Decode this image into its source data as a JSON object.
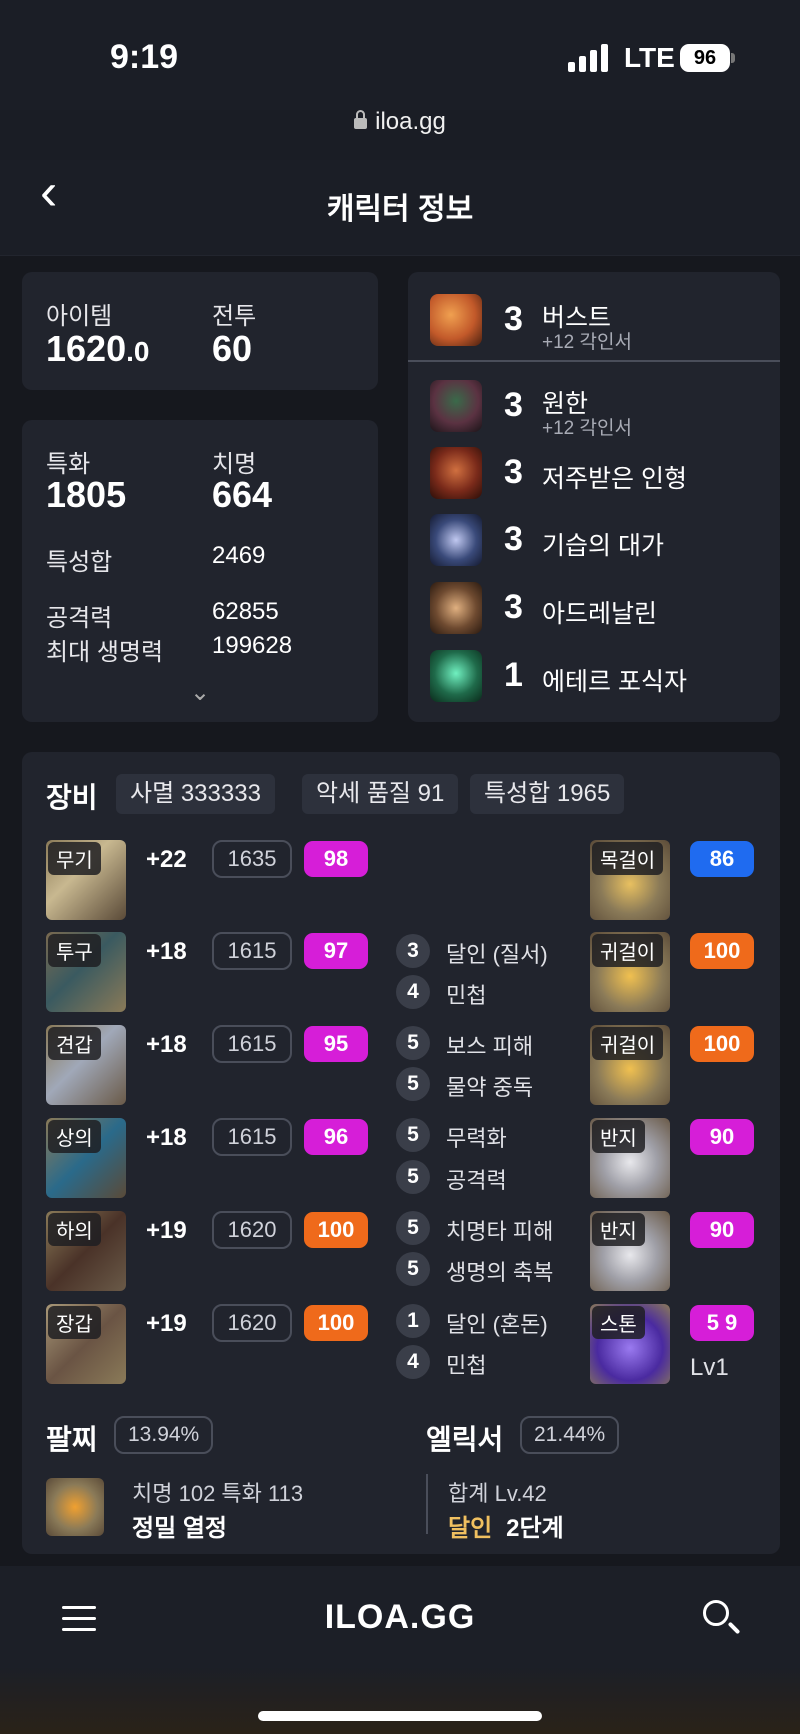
{
  "status": {
    "time": "9:19",
    "network": "LTE",
    "battery": "96"
  },
  "browser": {
    "url": "iloa.gg"
  },
  "header": {
    "back": "‹",
    "title": "캐릭터 정보"
  },
  "summary": {
    "item_label": "아이템",
    "item_value": "1620",
    "item_decimal": ".0",
    "combat_label": "전투",
    "combat_value": "60"
  },
  "stats": {
    "spec_label": "특화",
    "spec_value": "1805",
    "crit_label": "치명",
    "crit_value": "664",
    "total_label": "특성합",
    "total_value": "2469",
    "atk_label": "공격력",
    "atk_value": "62855",
    "hp_label": "최대 생명력",
    "hp_value": "199628",
    "expand": "⌄"
  },
  "engravings": [
    {
      "level": "3",
      "name": "버스트",
      "sub": "+12 각인서",
      "color": "#c2592a"
    },
    {
      "level": "3",
      "name": "원한",
      "sub": "+12 각인서",
      "color": "#5b3242"
    },
    {
      "level": "3",
      "name": "저주받은 인형",
      "sub": "",
      "color": "#7a2a1a"
    },
    {
      "level": "3",
      "name": "기습의 대가",
      "sub": "",
      "color": "#3a4a7a"
    },
    {
      "level": "3",
      "name": "아드레날린",
      "sub": "",
      "color": "#6e4a30"
    },
    {
      "level": "1",
      "name": "에테르 포식자",
      "sub": "",
      "color": "#1f6a4a"
    }
  ],
  "equipment": {
    "title": "장비",
    "pills": [
      "사멸 333333",
      "악세 품질 91",
      "특성합 1965"
    ],
    "armor": [
      {
        "tag": "무기",
        "refine": "+22",
        "ilvl": "1635",
        "quality": "98",
        "qcolor": "purple"
      },
      {
        "tag": "투구",
        "refine": "+18",
        "ilvl": "1615",
        "quality": "97",
        "qcolor": "purple"
      },
      {
        "tag": "견갑",
        "refine": "+18",
        "ilvl": "1615",
        "quality": "95",
        "qcolor": "purple"
      },
      {
        "tag": "상의",
        "refine": "+18",
        "ilvl": "1615",
        "quality": "96",
        "qcolor": "purple"
      },
      {
        "tag": "하의",
        "refine": "+19",
        "ilvl": "1620",
        "quality": "100",
        "qcolor": "orange"
      },
      {
        "tag": "장갑",
        "refine": "+19",
        "ilvl": "1620",
        "quality": "100",
        "qcolor": "orange"
      }
    ],
    "effects": [
      {
        "num": "3",
        "name": "달인 (질서)"
      },
      {
        "num": "4",
        "name": "민첩"
      },
      {
        "num": "5",
        "name": "보스 피해"
      },
      {
        "num": "5",
        "name": "물약 중독"
      },
      {
        "num": "5",
        "name": "무력화"
      },
      {
        "num": "5",
        "name": "공격력"
      },
      {
        "num": "5",
        "name": "치명타 피해"
      },
      {
        "num": "5",
        "name": "생명의 축복"
      },
      {
        "num": "1",
        "name": "달인 (혼돈)"
      },
      {
        "num": "4",
        "name": "민첩"
      }
    ],
    "accessories": [
      {
        "tag": "목걸이",
        "quality": "86",
        "qcolor": "blue"
      },
      {
        "tag": "귀걸이",
        "quality": "100",
        "qcolor": "orange"
      },
      {
        "tag": "귀걸이",
        "quality": "100",
        "qcolor": "orange"
      },
      {
        "tag": "반지",
        "quality": "90",
        "qcolor": "purple"
      },
      {
        "tag": "반지",
        "quality": "90",
        "qcolor": "purple"
      },
      {
        "tag": "스톤",
        "quality": "5 9",
        "qcolor": "purple",
        "sub": "Lv1"
      }
    ]
  },
  "bracelet": {
    "title": "팔찌",
    "percent": "13.94%",
    "line1": "치명 102  특화 113",
    "line2": "정밀  열정"
  },
  "elixir": {
    "title": "엘릭서",
    "percent": "21.44%",
    "line1": "합계 Lv.42",
    "highlight": "달인",
    "line2": "2단계"
  },
  "nav": {
    "logo": "ILOA.GG"
  }
}
